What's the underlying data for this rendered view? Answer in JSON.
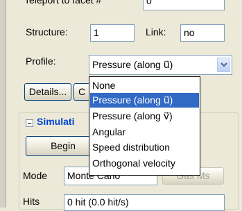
{
  "panel": {
    "teleport_label": "Teleport to facet #",
    "teleport_value": "0",
    "structure_label": "Structure:",
    "structure_value": "1",
    "link_label": "Link:",
    "link_value": "no",
    "profile_label": "Profile:",
    "profile_selected": "Pressure (along u⃗)",
    "details_button": "Details...",
    "second_button": "C"
  },
  "simulation": {
    "group_title": "Simulati",
    "begin_button": "Begin",
    "mode_label": "Mode",
    "mode_value": "Monte Carlo",
    "right_button": "Gas Ms",
    "hits_label": "Hits",
    "hits_value": "0 hit (0.0 hit/s)"
  },
  "profile_dropdown": {
    "options": [
      "None",
      "Pressure (along u⃗)",
      "Pressure (along v⃗)",
      "Angular",
      "Speed distribution",
      "Orthogonal velocity"
    ],
    "selected_index": 1
  },
  "colors": {
    "highlight": "#316ac5",
    "group_title": "#0046d5",
    "window_bg": "#ece9d8"
  }
}
